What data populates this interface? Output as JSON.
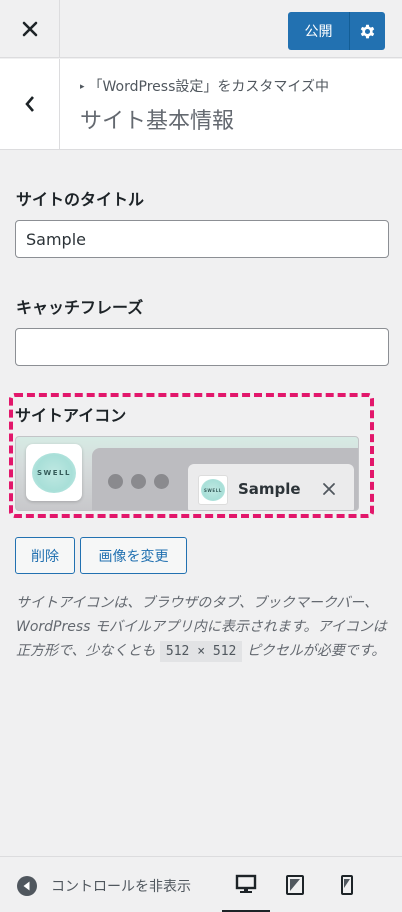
{
  "header": {
    "close_icon": "close-icon",
    "publish_label": "公開",
    "settings_icon": "gear-icon"
  },
  "section": {
    "breadcrumb_prefix": "「WordPress設定」をカスタマイズ中",
    "title": "サイト基本情報"
  },
  "fields": {
    "site_title_label": "サイトのタイトル",
    "site_title_value": "Sample",
    "tagline_label": "キャッチフレーズ",
    "tagline_value": ""
  },
  "site_icon": {
    "label": "サイトアイコン",
    "logo_text": "SWELL",
    "tab_title": "Sample",
    "remove_label": "削除",
    "change_label": "画像を変更",
    "description": "サイトアイコンは、ブラウザのタブ、ブックマークバー、WordPress モバイルアプリ内に表示されます。アイコンは正方形で、少なくとも",
    "size_code": "512 × 512",
    "description_end": "ピクセルが必要です。"
  },
  "footer": {
    "collapse_label": "コントロールを非表示",
    "devices": [
      "desktop",
      "tablet",
      "mobile"
    ],
    "active_device": "desktop"
  },
  "colors": {
    "accent": "#2271b1",
    "highlight": "#e2176b",
    "background": "#f0f0f1"
  }
}
